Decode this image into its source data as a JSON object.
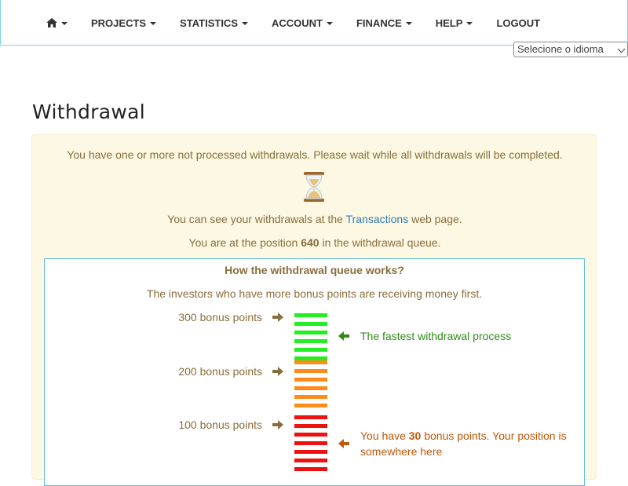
{
  "nav": {
    "items": [
      {
        "label": "",
        "icon": "home-icon",
        "dropdown": true
      },
      {
        "label": "PROJECTS",
        "dropdown": true
      },
      {
        "label": "STATISTICS",
        "dropdown": true
      },
      {
        "label": "ACCOUNT",
        "dropdown": true
      },
      {
        "label": "FINANCE",
        "dropdown": true
      },
      {
        "label": "HELP",
        "dropdown": true
      },
      {
        "label": "LOGOUT",
        "dropdown": false
      }
    ],
    "language_select": "Selecione o idioma"
  },
  "page_title": "Withdrawal",
  "notice": {
    "pending_text": "You have one or more not processed withdrawals. Please wait while all withdrawals will be completed.",
    "icon": "hourglass-icon",
    "see_prefix": "You can see your withdrawals at the",
    "see_link": "Transactions",
    "see_suffix": "web page.",
    "position_prefix": "You are at the position",
    "position_value": "640",
    "position_suffix": "in the withdrawal queue."
  },
  "queue": {
    "heading": "How the withdrawal queue works?",
    "description": "The investors who have more bonus points are receiving money first.",
    "levels": [
      {
        "label": "300 bonus points"
      },
      {
        "label": "200 bonus points"
      },
      {
        "label": "100 bonus points"
      }
    ],
    "fastest_text": "The fastest withdrawal process",
    "you_prefix": "You have",
    "you_points": "30",
    "you_suffix": "bonus points. Your position is somewhere here",
    "colors": {
      "green": "#22ee22",
      "orange": "#ff8c1a",
      "red": "#ee1111",
      "text_green": "#2e8b1a",
      "text_orange": "#c0570a",
      "arrow_brown": "#8a6d3b"
    }
  }
}
